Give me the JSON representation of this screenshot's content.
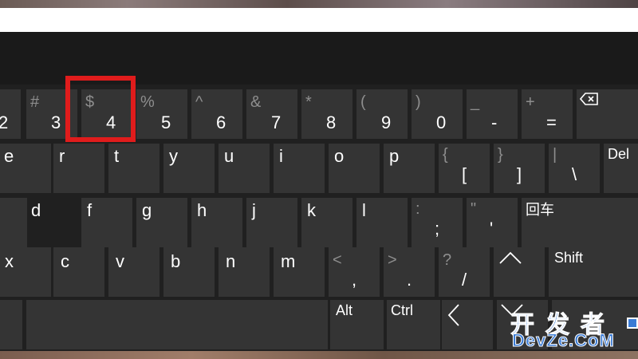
{
  "keyboard": {
    "row1": [
      {
        "name": "key-2",
        "main": "2",
        "secondary": ""
      },
      {
        "name": "key-3",
        "main": "3",
        "secondary": "#"
      },
      {
        "name": "key-4",
        "main": "4",
        "secondary": "$"
      },
      {
        "name": "key-5",
        "main": "5",
        "secondary": "%"
      },
      {
        "name": "key-6",
        "main": "6",
        "secondary": "^"
      },
      {
        "name": "key-7",
        "main": "7",
        "secondary": "&"
      },
      {
        "name": "key-8",
        "main": "8",
        "secondary": "*"
      },
      {
        "name": "key-9",
        "main": "9",
        "secondary": "("
      },
      {
        "name": "key-0",
        "main": "0",
        "secondary": ")"
      },
      {
        "name": "key-minus",
        "main": "-",
        "secondary": "_"
      },
      {
        "name": "key-equals",
        "main": "=",
        "secondary": "+"
      }
    ],
    "row2": [
      {
        "name": "key-e",
        "main": "e"
      },
      {
        "name": "key-r",
        "main": "r"
      },
      {
        "name": "key-t",
        "main": "t"
      },
      {
        "name": "key-y",
        "main": "y"
      },
      {
        "name": "key-u",
        "main": "u"
      },
      {
        "name": "key-i",
        "main": "i"
      },
      {
        "name": "key-o",
        "main": "o"
      },
      {
        "name": "key-p",
        "main": "p"
      },
      {
        "name": "key-left-bracket",
        "main": "[",
        "secondary": "{"
      },
      {
        "name": "key-right-bracket",
        "main": "]",
        "secondary": "}"
      },
      {
        "name": "key-backslash",
        "main": "\\",
        "secondary": "|"
      }
    ],
    "row3": [
      {
        "name": "key-d",
        "main": "d"
      },
      {
        "name": "key-f",
        "main": "f"
      },
      {
        "name": "key-g",
        "main": "g"
      },
      {
        "name": "key-h",
        "main": "h"
      },
      {
        "name": "key-j",
        "main": "j"
      },
      {
        "name": "key-k",
        "main": "k"
      },
      {
        "name": "key-l",
        "main": "l"
      },
      {
        "name": "key-semicolon",
        "main": ";",
        "secondary": ":"
      },
      {
        "name": "key-quote",
        "main": "'",
        "secondary": "\""
      }
    ],
    "row4": [
      {
        "name": "key-x",
        "main": "x"
      },
      {
        "name": "key-c",
        "main": "c"
      },
      {
        "name": "key-v",
        "main": "v"
      },
      {
        "name": "key-b",
        "main": "b"
      },
      {
        "name": "key-n",
        "main": "n"
      },
      {
        "name": "key-m",
        "main": "m"
      },
      {
        "name": "key-comma",
        "main": ",",
        "secondary": "<"
      },
      {
        "name": "key-period",
        "main": ".",
        "secondary": ">"
      },
      {
        "name": "key-slash",
        "main": "/",
        "secondary": "?"
      }
    ],
    "labels": {
      "del": "Del",
      "enter": "回车",
      "shift": "Shift",
      "alt": "Alt",
      "ctrl": "Ctrl"
    },
    "icons": {
      "backspace": "backspace-icon",
      "up": "chevron-up-icon",
      "left": "chevron-left-icon",
      "down": "chevron-down-icon"
    },
    "highlight_key": "key-4",
    "highlight_color": "#e01c1c"
  },
  "watermark": {
    "chinese": "开发者",
    "latin": "DevZe.CoM"
  }
}
